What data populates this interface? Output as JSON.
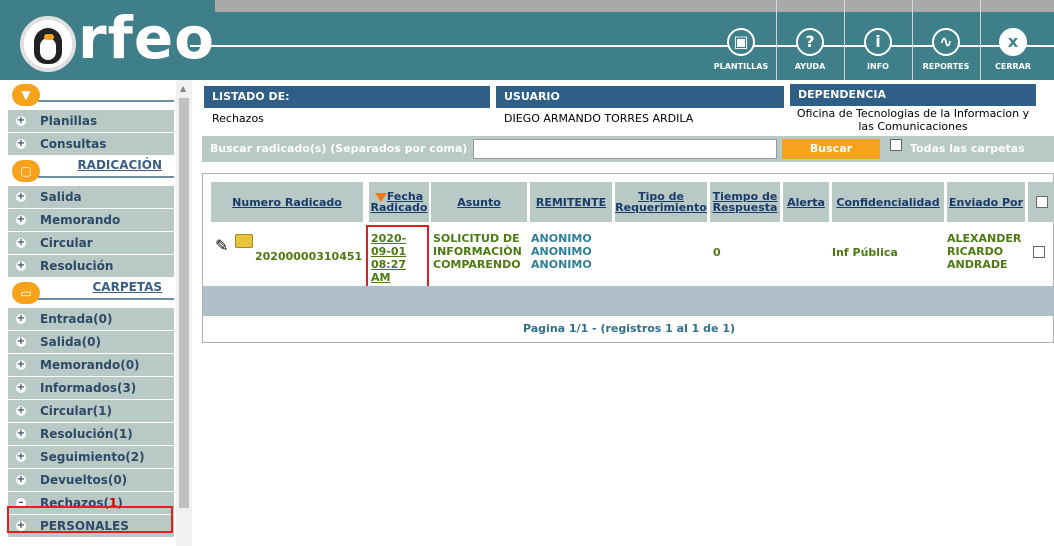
{
  "header": {
    "logo_text": "rfeo",
    "buttons": [
      {
        "label": "PLANTILLAS",
        "icon": "templates-icon",
        "glyph": "▣"
      },
      {
        "label": "AYUDA",
        "icon": "help-icon",
        "glyph": "?"
      },
      {
        "label": "INFO",
        "icon": "info-icon",
        "glyph": "i"
      },
      {
        "label": "REPORTES",
        "icon": "reports-icon",
        "glyph": "∿"
      },
      {
        "label": "CERRAR",
        "icon": "close-icon",
        "glyph": "x"
      }
    ]
  },
  "sidebar": {
    "top_items": [
      {
        "label": "Planillas"
      },
      {
        "label": "Consultas"
      }
    ],
    "radicacion": {
      "title": "RADICACIÓN",
      "items": [
        {
          "label": "Salida"
        },
        {
          "label": "Memorando"
        },
        {
          "label": "Circular"
        },
        {
          "label": "Resolución"
        }
      ]
    },
    "carpetas": {
      "title": "CARPETAS",
      "items": [
        {
          "label": "Entrada(0)"
        },
        {
          "label": "Salida(0)"
        },
        {
          "label": "Memorando(0)"
        },
        {
          "label": "Informados(3)"
        },
        {
          "label": "Circular(1)"
        },
        {
          "label": "Resolución(1)"
        },
        {
          "label": "Seguimiento(2)"
        },
        {
          "label": "Devueltos(0)"
        }
      ],
      "selected": {
        "label": "Rechazos(",
        "count": "1",
        "suffix": ")"
      },
      "personales": "PERSONALES"
    }
  },
  "info": {
    "listado_header": "LISTADO DE:",
    "listado_value": "Rechazos",
    "usuario_header": "USUARIO",
    "usuario_value": "DIEGO ARMANDO TORRES ARDILA",
    "dependencia_header": "DEPENDENCIA",
    "dependencia_value": "Oficina de Tecnologias de la Informacion y las Comunicaciones"
  },
  "search": {
    "label": "Buscar radicado(s) (Separados por coma)",
    "value": "",
    "button": "Buscar",
    "all_folders_label": "Todas las carpetas"
  },
  "results": {
    "columns": [
      "Numero Radicado",
      "Fecha Radicado",
      "Asunto",
      "REMITENTE",
      "Tipo de Requerimiento",
      "Tiempo de Respuesta",
      "Alerta",
      "Confidencialidad",
      "Enviado Por"
    ],
    "row": {
      "numero": "20200000310451",
      "fecha": "2020-09-01 08:27 AM",
      "asunto": "SOLICITUD DE INFORMACIÒN COMPARENDO",
      "remitente": "ANONIMO ANONIMO ANONIMO",
      "tipo": "",
      "tiempo": "0",
      "alerta": "",
      "confidencialidad": "Inf Pública",
      "enviado_por": "ALEXANDER RICARDO ANDRADE"
    },
    "pager": "Pagina 1/1   -   (registros 1 al 1 de 1)"
  },
  "colors": {
    "header_bg": "#3f7f8a",
    "accent_orange": "#f7a21b",
    "nav_bg": "#b9c9c6",
    "table_header_blue": "#2f5f86",
    "highlight_red": "#e02020"
  }
}
